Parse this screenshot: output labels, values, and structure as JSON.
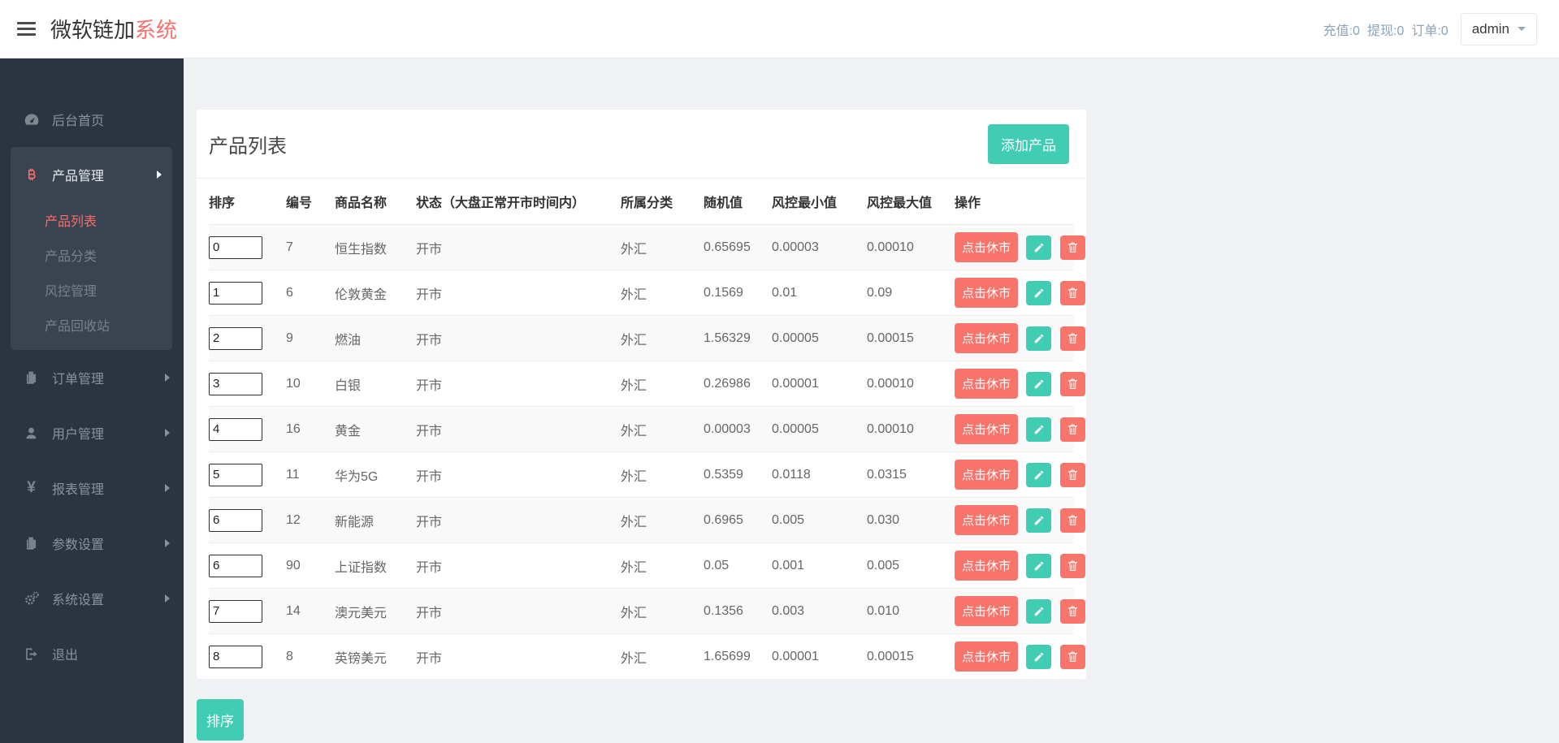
{
  "header": {
    "brand_primary": "微软链加",
    "brand_accent": "系统",
    "stats": [
      "充值:0",
      "提现:0",
      "订单:0"
    ],
    "user_menu": {
      "label": "admin"
    }
  },
  "sidebar": {
    "items": [
      {
        "label": "后台首页",
        "icon": "dashboard-icon"
      },
      {
        "label": "产品管理",
        "icon": "bitcoin-icon",
        "active": true,
        "children": [
          {
            "label": "产品列表",
            "active": true
          },
          {
            "label": "产品分类"
          },
          {
            "label": "风控管理"
          },
          {
            "label": "产品回收站"
          }
        ]
      },
      {
        "label": "订单管理",
        "icon": "files-icon"
      },
      {
        "label": "用户管理",
        "icon": "user-icon"
      },
      {
        "label": "报表管理",
        "icon": "yen-icon"
      },
      {
        "label": "参数设置",
        "icon": "files-icon"
      },
      {
        "label": "系统设置",
        "icon": "gears-icon"
      },
      {
        "label": "退出",
        "icon": "sign-out-icon"
      }
    ]
  },
  "main": {
    "card_title": "产品列表",
    "add_button_label": "添加产品",
    "sort_button_label": "排序",
    "table": {
      "headers": [
        "排序",
        "编号",
        "商品名称",
        "状态（大盘正常开市时间内）",
        "所属分类",
        "随机值",
        "风控最小值",
        "风控最大值",
        "操作"
      ],
      "close_market_label": "点击休市",
      "rows": [
        {
          "sort": "0",
          "id": "7",
          "name": "恒生指数",
          "status": "开市",
          "category": "外汇",
          "random": "0.65695",
          "risk_min": "0.00003",
          "risk_max": "0.00010"
        },
        {
          "sort": "1",
          "id": "6",
          "name": "伦敦黄金",
          "status": "开市",
          "category": "外汇",
          "random": "0.1569",
          "risk_min": "0.01",
          "risk_max": "0.09"
        },
        {
          "sort": "2",
          "id": "9",
          "name": "燃油",
          "status": "开市",
          "category": "外汇",
          "random": "1.56329",
          "risk_min": "0.00005",
          "risk_max": "0.00015"
        },
        {
          "sort": "3",
          "id": "10",
          "name": "白银",
          "status": "开市",
          "category": "外汇",
          "random": "0.26986",
          "risk_min": "0.00001",
          "risk_max": "0.00010"
        },
        {
          "sort": "4",
          "id": "16",
          "name": "黄金",
          "status": "开市",
          "category": "外汇",
          "random": "0.00003",
          "risk_min": "0.00005",
          "risk_max": "0.00010"
        },
        {
          "sort": "5",
          "id": "11",
          "name": "华为5G",
          "status": "开市",
          "category": "外汇",
          "random": "0.5359",
          "risk_min": "0.0118",
          "risk_max": "0.0315"
        },
        {
          "sort": "6",
          "id": "12",
          "name": "新能源",
          "status": "开市",
          "category": "外汇",
          "random": "0.6965",
          "risk_min": "0.005",
          "risk_max": "0.030"
        },
        {
          "sort": "6",
          "id": "90",
          "name": "上证指数",
          "status": "开市",
          "category": "外汇",
          "random": "0.05",
          "risk_min": "0.001",
          "risk_max": "0.005"
        },
        {
          "sort": "7",
          "id": "14",
          "name": "澳元美元",
          "status": "开市",
          "category": "外汇",
          "random": "0.1356",
          "risk_min": "0.003",
          "risk_max": "0.010"
        },
        {
          "sort": "8",
          "id": "8",
          "name": "英镑美元",
          "status": "开市",
          "category": "外汇",
          "random": "1.65699",
          "risk_min": "0.00001",
          "risk_max": "0.00015"
        }
      ]
    }
  },
  "colors": {
    "accent_teal": "#41ccb4",
    "accent_salmon": "#f9756c",
    "sidebar_bg": "#2b3541",
    "sidebar_active_bg": "#3a4450",
    "page_bg": "#eff1f4",
    "stats_text": "#8ba3b8"
  }
}
